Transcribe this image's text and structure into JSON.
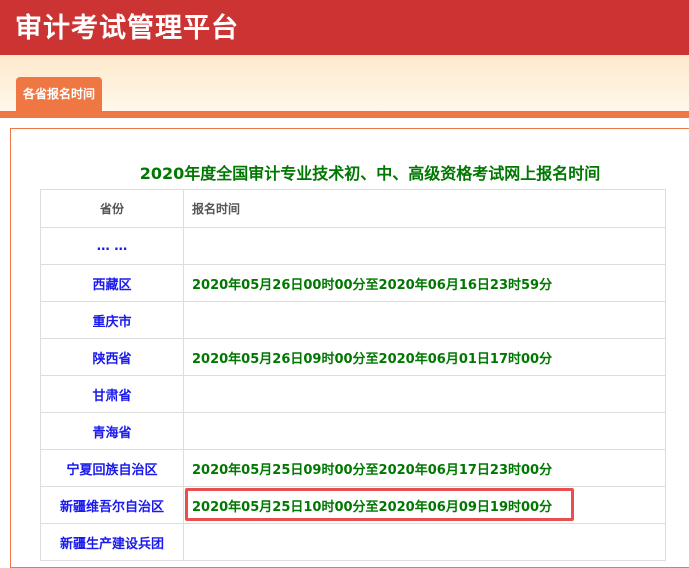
{
  "header": {
    "title": "审计考试管理平台"
  },
  "tabs": [
    {
      "label": "各省报名时间"
    }
  ],
  "main": {
    "title": "2020年度全国审计专业技术初、中、高级资格考试网上报名时间",
    "columns": [
      "省份",
      "报名时间"
    ],
    "rows": [
      {
        "province": "… …",
        "time": ""
      },
      {
        "province": "西藏区",
        "time": "2020年05月26日00时00分至2020年06月16日23时59分"
      },
      {
        "province": "重庆市",
        "time": ""
      },
      {
        "province": "陕西省",
        "time": "2020年05月26日09时00分至2020年06月01日17时00分"
      },
      {
        "province": "甘肃省",
        "time": ""
      },
      {
        "province": "青海省",
        "time": ""
      },
      {
        "province": "宁夏回族自治区",
        "time": "2020年05月25日09时00分至2020年06月17日23时00分"
      },
      {
        "province": "新疆维吾尔自治区",
        "time": "2020年05月25日10时00分至2020年06月09日19时00分"
      },
      {
        "province": "新疆生产建设兵团",
        "time": ""
      }
    ]
  }
}
